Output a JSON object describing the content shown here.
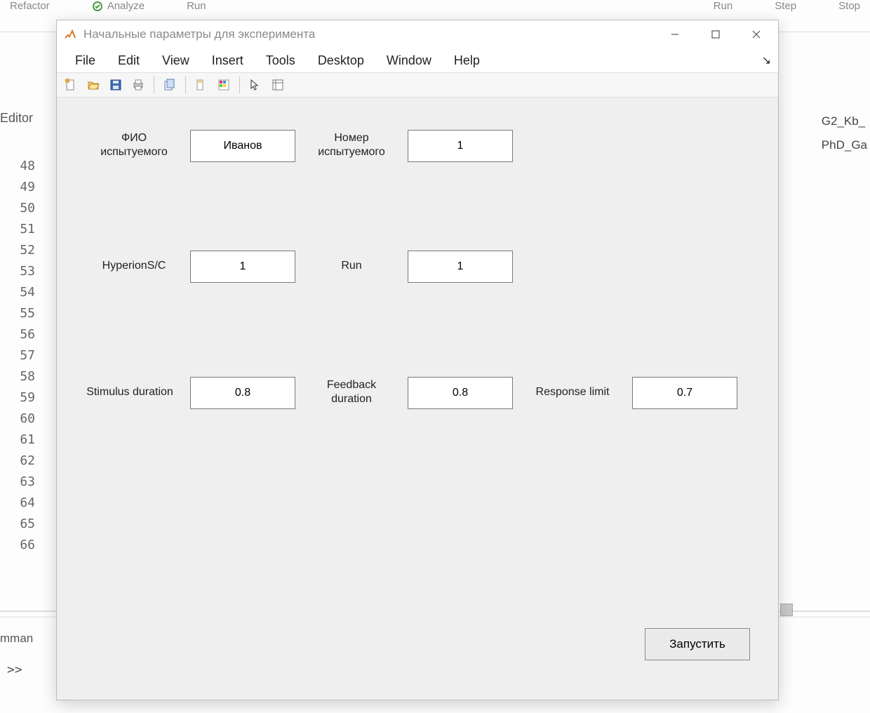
{
  "background": {
    "top_items_left": [
      "Refactor",
      "Analyze",
      "Run"
    ],
    "top_items_right": [
      "Run",
      "Step",
      "Stop"
    ],
    "editor_label": "Editor",
    "gutter_lines": [
      "48",
      "49",
      "50",
      "51",
      "52",
      "53",
      "54",
      "55",
      "56",
      "57",
      "58",
      "59",
      "60",
      "61",
      "62",
      "63",
      "64",
      "65",
      "66"
    ],
    "right_files": [
      "G2_Kb_",
      "PhD_Ga"
    ],
    "cmd_label": "mman",
    "prompt": ">>"
  },
  "window": {
    "title": "Начальные параметры для эксперимента",
    "menus": [
      "File",
      "Edit",
      "View",
      "Insert",
      "Tools",
      "Desktop",
      "Window",
      "Help"
    ],
    "toolbar_icons": [
      "new-file",
      "open-folder",
      "save",
      "print",
      "figure-properties",
      "datatip",
      "legend",
      "pointer",
      "axes-properties"
    ]
  },
  "form": {
    "subject_name": {
      "label": "ФИО\nиспытуемого",
      "value": "Иванов"
    },
    "subject_number": {
      "label": "Номер\nиспытуемого",
      "value": "1"
    },
    "hyperion": {
      "label": "HyperionS/C",
      "value": "1"
    },
    "run": {
      "label": "Run",
      "value": "1"
    },
    "stimulus_duration": {
      "label": "Stimulus duration",
      "value": "0.8"
    },
    "feedback_duration": {
      "label": "Feedback\nduration",
      "value": "0.8"
    },
    "response_limit": {
      "label": "Response limit",
      "value": "0.7"
    },
    "launch_button": "Запустить"
  }
}
